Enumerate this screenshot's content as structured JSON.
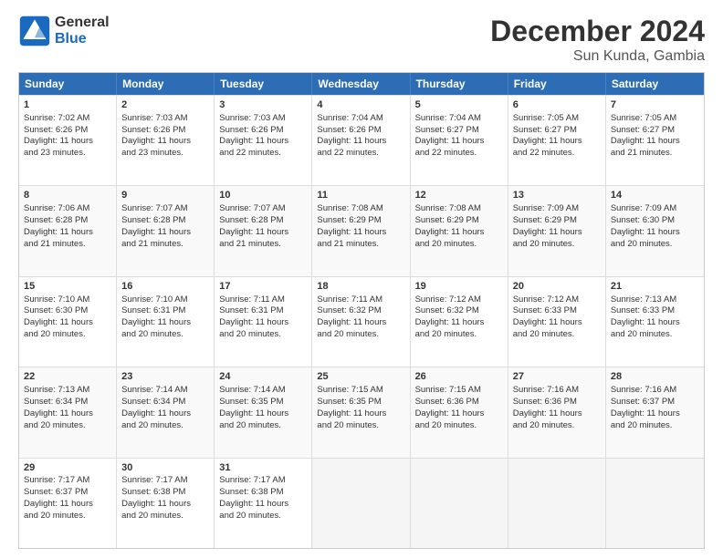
{
  "header": {
    "logo_general": "General",
    "logo_blue": "Blue",
    "title": "December 2024",
    "subtitle": "Sun Kunda, Gambia"
  },
  "calendar": {
    "days": [
      "Sunday",
      "Monday",
      "Tuesday",
      "Wednesday",
      "Thursday",
      "Friday",
      "Saturday"
    ],
    "rows": [
      [
        {
          "day": "1",
          "info": "Sunrise: 7:02 AM\nSunset: 6:26 PM\nDaylight: 11 hours\nand 23 minutes."
        },
        {
          "day": "2",
          "info": "Sunrise: 7:03 AM\nSunset: 6:26 PM\nDaylight: 11 hours\nand 23 minutes."
        },
        {
          "day": "3",
          "info": "Sunrise: 7:03 AM\nSunset: 6:26 PM\nDaylight: 11 hours\nand 22 minutes."
        },
        {
          "day": "4",
          "info": "Sunrise: 7:04 AM\nSunset: 6:26 PM\nDaylight: 11 hours\nand 22 minutes."
        },
        {
          "day": "5",
          "info": "Sunrise: 7:04 AM\nSunset: 6:27 PM\nDaylight: 11 hours\nand 22 minutes."
        },
        {
          "day": "6",
          "info": "Sunrise: 7:05 AM\nSunset: 6:27 PM\nDaylight: 11 hours\nand 22 minutes."
        },
        {
          "day": "7",
          "info": "Sunrise: 7:05 AM\nSunset: 6:27 PM\nDaylight: 11 hours\nand 21 minutes."
        }
      ],
      [
        {
          "day": "8",
          "info": "Sunrise: 7:06 AM\nSunset: 6:28 PM\nDaylight: 11 hours\nand 21 minutes."
        },
        {
          "day": "9",
          "info": "Sunrise: 7:07 AM\nSunset: 6:28 PM\nDaylight: 11 hours\nand 21 minutes."
        },
        {
          "day": "10",
          "info": "Sunrise: 7:07 AM\nSunset: 6:28 PM\nDaylight: 11 hours\nand 21 minutes."
        },
        {
          "day": "11",
          "info": "Sunrise: 7:08 AM\nSunset: 6:29 PM\nDaylight: 11 hours\nand 21 minutes."
        },
        {
          "day": "12",
          "info": "Sunrise: 7:08 AM\nSunset: 6:29 PM\nDaylight: 11 hours\nand 20 minutes."
        },
        {
          "day": "13",
          "info": "Sunrise: 7:09 AM\nSunset: 6:29 PM\nDaylight: 11 hours\nand 20 minutes."
        },
        {
          "day": "14",
          "info": "Sunrise: 7:09 AM\nSunset: 6:30 PM\nDaylight: 11 hours\nand 20 minutes."
        }
      ],
      [
        {
          "day": "15",
          "info": "Sunrise: 7:10 AM\nSunset: 6:30 PM\nDaylight: 11 hours\nand 20 minutes."
        },
        {
          "day": "16",
          "info": "Sunrise: 7:10 AM\nSunset: 6:31 PM\nDaylight: 11 hours\nand 20 minutes."
        },
        {
          "day": "17",
          "info": "Sunrise: 7:11 AM\nSunset: 6:31 PM\nDaylight: 11 hours\nand 20 minutes."
        },
        {
          "day": "18",
          "info": "Sunrise: 7:11 AM\nSunset: 6:32 PM\nDaylight: 11 hours\nand 20 minutes."
        },
        {
          "day": "19",
          "info": "Sunrise: 7:12 AM\nSunset: 6:32 PM\nDaylight: 11 hours\nand 20 minutes."
        },
        {
          "day": "20",
          "info": "Sunrise: 7:12 AM\nSunset: 6:33 PM\nDaylight: 11 hours\nand 20 minutes."
        },
        {
          "day": "21",
          "info": "Sunrise: 7:13 AM\nSunset: 6:33 PM\nDaylight: 11 hours\nand 20 minutes."
        }
      ],
      [
        {
          "day": "22",
          "info": "Sunrise: 7:13 AM\nSunset: 6:34 PM\nDaylight: 11 hours\nand 20 minutes."
        },
        {
          "day": "23",
          "info": "Sunrise: 7:14 AM\nSunset: 6:34 PM\nDaylight: 11 hours\nand 20 minutes."
        },
        {
          "day": "24",
          "info": "Sunrise: 7:14 AM\nSunset: 6:35 PM\nDaylight: 11 hours\nand 20 minutes."
        },
        {
          "day": "25",
          "info": "Sunrise: 7:15 AM\nSunset: 6:35 PM\nDaylight: 11 hours\nand 20 minutes."
        },
        {
          "day": "26",
          "info": "Sunrise: 7:15 AM\nSunset: 6:36 PM\nDaylight: 11 hours\nand 20 minutes."
        },
        {
          "day": "27",
          "info": "Sunrise: 7:16 AM\nSunset: 6:36 PM\nDaylight: 11 hours\nand 20 minutes."
        },
        {
          "day": "28",
          "info": "Sunrise: 7:16 AM\nSunset: 6:37 PM\nDaylight: 11 hours\nand 20 minutes."
        }
      ],
      [
        {
          "day": "29",
          "info": "Sunrise: 7:17 AM\nSunset: 6:37 PM\nDaylight: 11 hours\nand 20 minutes."
        },
        {
          "day": "30",
          "info": "Sunrise: 7:17 AM\nSunset: 6:38 PM\nDaylight: 11 hours\nand 20 minutes."
        },
        {
          "day": "31",
          "info": "Sunrise: 7:17 AM\nSunset: 6:38 PM\nDaylight: 11 hours\nand 20 minutes."
        },
        {
          "day": "",
          "info": ""
        },
        {
          "day": "",
          "info": ""
        },
        {
          "day": "",
          "info": ""
        },
        {
          "day": "",
          "info": ""
        }
      ]
    ]
  }
}
